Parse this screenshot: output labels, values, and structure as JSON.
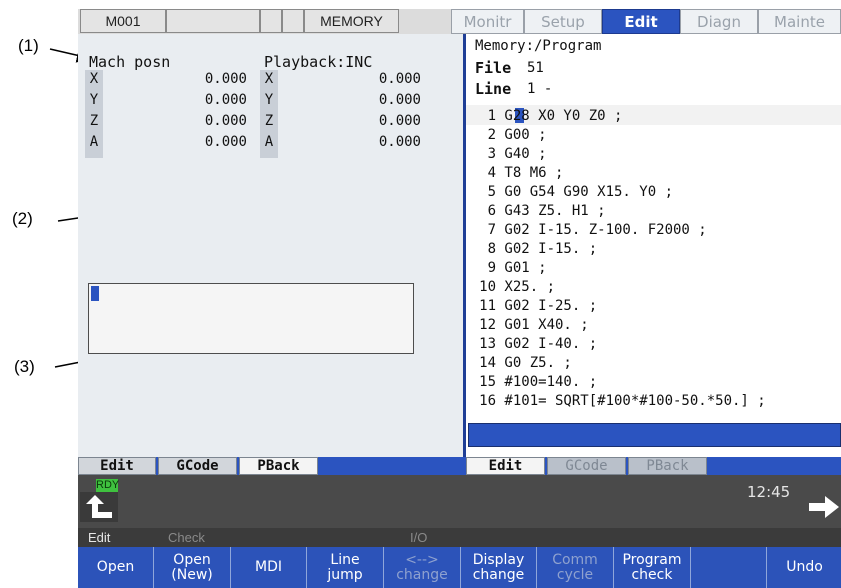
{
  "callouts": [
    "(1)",
    "(2)",
    "(3)"
  ],
  "top_bar": {
    "program": "M001",
    "mode": "MEMORY",
    "tabs": [
      {
        "label": "Monitr",
        "active": false
      },
      {
        "label": "Setup",
        "active": false
      },
      {
        "label": "Edit",
        "active": true
      },
      {
        "label": "Diagn",
        "active": false
      },
      {
        "label": "Mainte",
        "active": false
      }
    ]
  },
  "left_panel": {
    "mach_title": "Mach posn",
    "playback_title": "Playback:INC",
    "axes": [
      {
        "name": "X",
        "mach": "0.000",
        "pb_name": "X",
        "pb": "0.000"
      },
      {
        "name": "Y",
        "mach": "0.000",
        "pb_name": "Y",
        "pb": "0.000"
      },
      {
        "name": "Z",
        "mach": "0.000",
        "pb_name": "Z",
        "pb": "0.000"
      },
      {
        "name": "A",
        "mach": "0.000",
        "pb_name": "A",
        "pb": "0.000"
      }
    ],
    "tabs": [
      "Edit",
      "GCode",
      "PBack"
    ]
  },
  "right_panel": {
    "path": "Memory:/Program",
    "file_label": "File",
    "file_value": "51",
    "line_label": "Line",
    "line_value": "1 -",
    "lines": [
      {
        "n": "1",
        "code": "G28 X0 Y0 Z0 ;"
      },
      {
        "n": "2",
        "code": "G00 ;"
      },
      {
        "n": "3",
        "code": "G40 ;"
      },
      {
        "n": "4",
        "code": "T8 M6 ;"
      },
      {
        "n": "5",
        "code": "G0 G54 G90 X15. Y0 ;"
      },
      {
        "n": "6",
        "code": "G43 Z5. H1 ;"
      },
      {
        "n": "7",
        "code": "G02 I-15. Z-100. F2000 ;"
      },
      {
        "n": "8",
        "code": "G02 I-15. ;"
      },
      {
        "n": "9",
        "code": "G01 ;"
      },
      {
        "n": "10",
        "code": "X25. ;"
      },
      {
        "n": "11",
        "code": "G02 I-25. ;"
      },
      {
        "n": "12",
        "code": "G01 X40. ;"
      },
      {
        "n": "13",
        "code": "G02 I-40. ;"
      },
      {
        "n": "14",
        "code": "G0 Z5. ;"
      },
      {
        "n": "15",
        "code": "#100=140. ;"
      },
      {
        "n": "16",
        "code": "#101= SQRT[#100*#100-50.*50.] ;"
      }
    ],
    "tabs": [
      "Edit",
      "GCode",
      "PBack"
    ]
  },
  "status": {
    "ready": "RDY",
    "time": "12:45"
  },
  "menu_row": {
    "edit": "Edit",
    "check": "Check",
    "io": "I/O"
  },
  "softkeys": [
    {
      "l1": "Open",
      "l2": "",
      "dim": false
    },
    {
      "l1": "Open",
      "l2": "(New)",
      "dim": false
    },
    {
      "l1": "MDI",
      "l2": "",
      "dim": false
    },
    {
      "l1": "Line",
      "l2": "jump",
      "dim": false
    },
    {
      "l1": "<-->",
      "l2": "change",
      "dim": true
    },
    {
      "l1": "Display",
      "l2": "change",
      "dim": false
    },
    {
      "l1": "Comm",
      "l2": "cycle",
      "dim": true
    },
    {
      "l1": "Program",
      "l2": "check",
      "dim": false
    },
    {
      "l1": "",
      "l2": "",
      "dim": false
    },
    {
      "l1": "Undo",
      "l2": "",
      "dim": false
    }
  ],
  "colors": {
    "accent": "#2b54c0",
    "ready_bg": "#3fc13f"
  }
}
